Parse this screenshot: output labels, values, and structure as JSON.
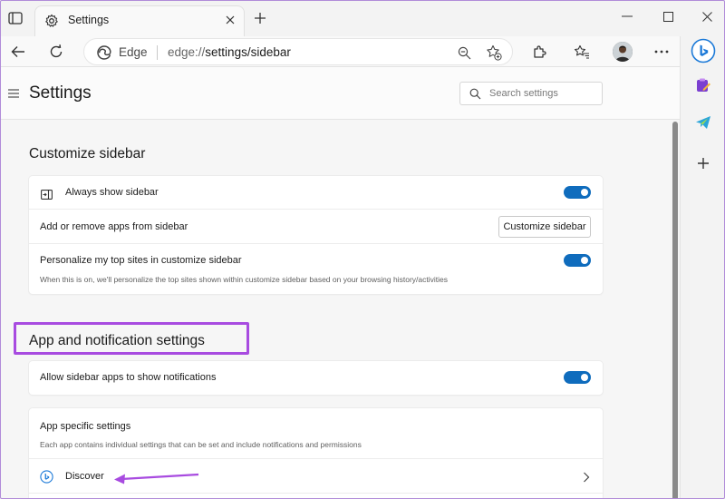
{
  "browser": {
    "tab": {
      "title": "Settings"
    },
    "address": {
      "site": "Edge",
      "url_prefix": "edge://",
      "url_rest": "settings/sidebar"
    }
  },
  "page": {
    "title": "Settings",
    "search": {
      "placeholder": "Search settings"
    }
  },
  "customize_sidebar": {
    "title": "Customize sidebar",
    "always_show": {
      "label": "Always show sidebar",
      "enabled": true
    },
    "add_remove": {
      "label": "Add or remove apps from sidebar",
      "button": "Customize sidebar"
    },
    "personalize": {
      "label": "Personalize my top sites in customize sidebar",
      "description": "When this is on, we'll personalize the top sites shown within customize sidebar based on your browsing history/activities",
      "enabled": true
    }
  },
  "app_notifications": {
    "title": "App and notification settings",
    "allow_notifications": {
      "label": "Allow sidebar apps to show notifications",
      "enabled": true
    },
    "app_specific": {
      "label": "App specific settings",
      "description": "Each app contains individual settings that can be set and include notifications and permissions"
    },
    "apps": [
      {
        "label": "Discover",
        "icon": "bing-discover-icon"
      }
    ]
  },
  "colors": {
    "toggle_on": "#0f6cbd",
    "highlight": "#a84be0"
  }
}
